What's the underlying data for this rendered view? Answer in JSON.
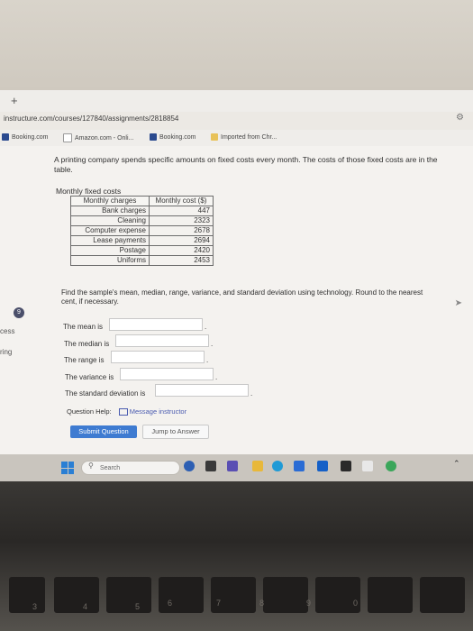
{
  "browser": {
    "new_tab_glyph": "+",
    "url": "instructure.com/courses/127840/assignments/2818854",
    "bookmarks": [
      {
        "label": "Booking.com",
        "icon": "booking-icon"
      },
      {
        "label": "Amazon.com - Onli...",
        "icon": "amazon-icon"
      },
      {
        "label": "Booking.com",
        "icon": "booking-icon"
      },
      {
        "label": "Imported from Chr...",
        "icon": "folder-icon"
      }
    ]
  },
  "question": {
    "number": "9",
    "intro": "A printing company spends specific amounts on fixed costs every month. The costs of those fixed costs are in the table.",
    "table_caption": "Monthly fixed costs",
    "table_headers": [
      "Monthly charges",
      "Monthly cost ($)"
    ],
    "rows": [
      {
        "charge": "Bank charges",
        "cost": "447"
      },
      {
        "charge": "Cleaning",
        "cost": "2323"
      },
      {
        "charge": "Computer expense",
        "cost": "2678"
      },
      {
        "charge": "Lease payments",
        "cost": "2694"
      },
      {
        "charge": "Postage",
        "cost": "2420"
      },
      {
        "charge": "Uniforms",
        "cost": "2453"
      }
    ],
    "instructions": "Find the sample's mean, median, range, variance, and standard deviation using technology. Round to the nearest cent, if necessary.",
    "answers": {
      "mean_label": "The mean is",
      "median_label": "The median is",
      "range_label": "The range is",
      "variance_label": "The variance is",
      "stddev_label": "The standard deviation is",
      "mean_value": "",
      "median_value": "",
      "range_value": "",
      "variance_value": "",
      "stddev_value": "",
      "end_punct": "."
    },
    "help_label": "Question Help:",
    "message_label": "Message instructor",
    "submit_label": "Submit Question",
    "jump_label": "Jump to Answer"
  },
  "sidebar": {
    "item_1": "cess",
    "item_2": "ring"
  },
  "taskbar": {
    "search_label": "Search"
  },
  "keyboard": {
    "digits": [
      "3",
      "4",
      "5",
      "6",
      "7",
      "8",
      "9",
      "0"
    ]
  },
  "colors": {
    "accent": "#3e7bd1",
    "link": "#4a5bb0"
  }
}
